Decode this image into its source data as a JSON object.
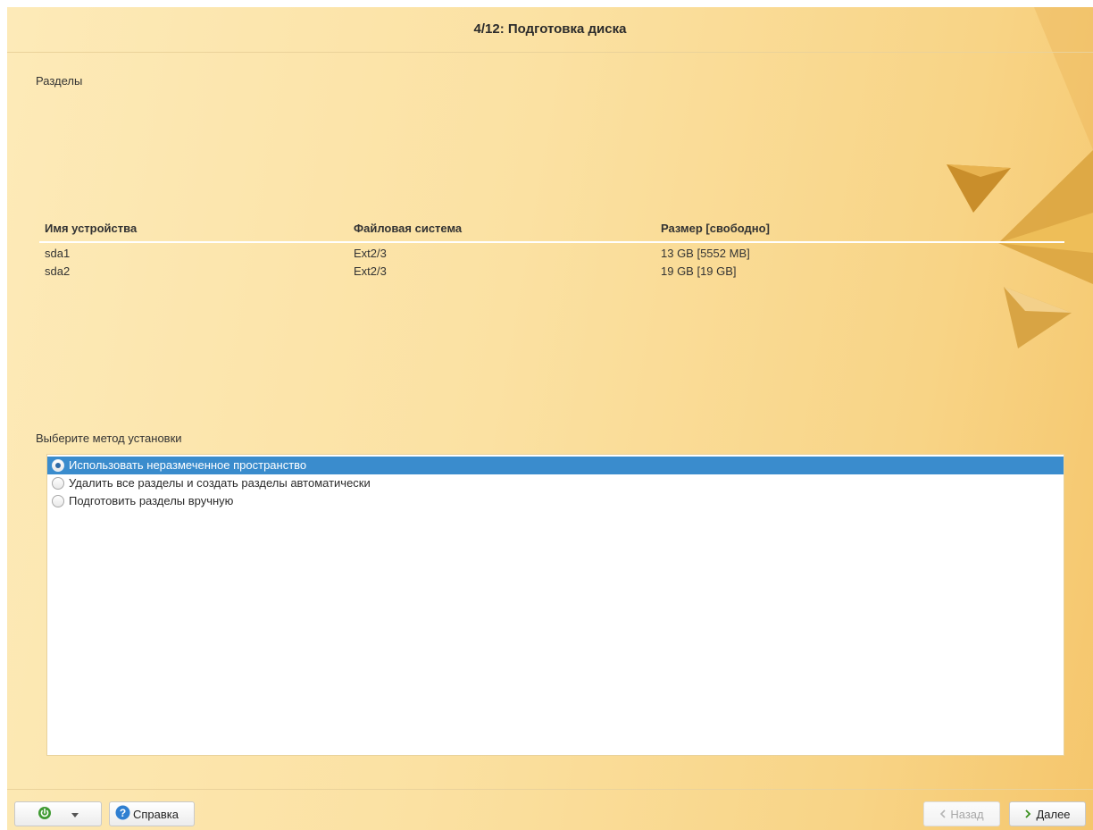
{
  "header": {
    "title": "4/12: Подготовка диска"
  },
  "partitions": {
    "label": "Разделы",
    "columns": [
      "Имя устройства",
      "Файловая система",
      "Размер [свободно]"
    ],
    "rows": [
      [
        "sda1",
        "Ext2/3",
        "13 GB [5552 MB]"
      ],
      [
        "sda2",
        "Ext2/3",
        "19 GB [19 GB]"
      ]
    ]
  },
  "method": {
    "label": "Выберите метод установки",
    "options": [
      "Использовать неразмеченное пространство",
      "Удалить все разделы и создать разделы автоматически",
      "Подготовить разделы вручную"
    ],
    "selected_index": 0
  },
  "footer": {
    "help_label": "Справка",
    "back_label": "Назад",
    "next_label": "Далее"
  },
  "colors": {
    "selection": "#3a8ccd",
    "background": "#fbe1a2"
  },
  "icons": {
    "power": "power-icon",
    "dropdown": "chevron-down-icon",
    "help": "help-icon",
    "back": "chevron-left-icon",
    "next": "chevron-right-icon"
  }
}
